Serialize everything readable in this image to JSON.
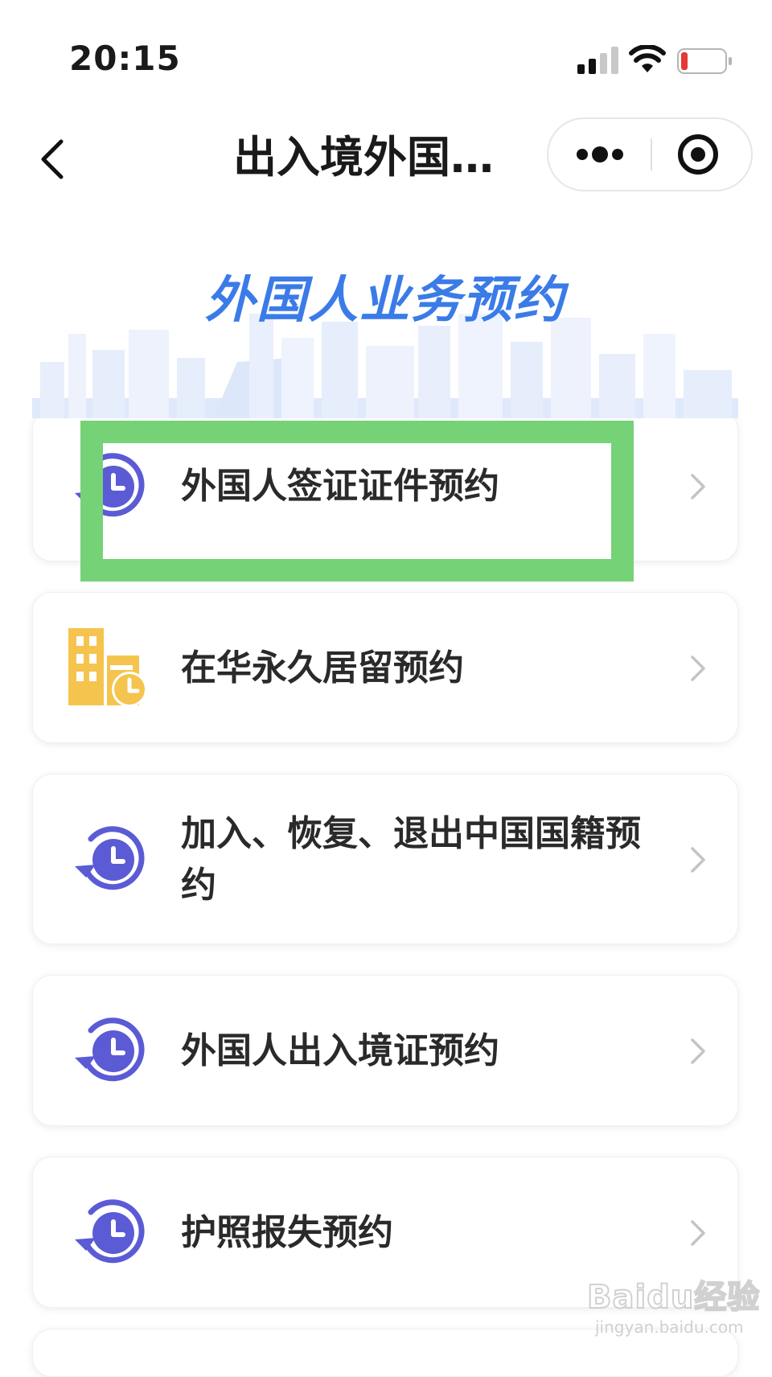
{
  "status_bar": {
    "time": "20:15"
  },
  "nav": {
    "title": "出入境外国…"
  },
  "banner": {
    "title": "外国人业务预约"
  },
  "services": [
    {
      "label": "外国人签证证件预约",
      "icon": "clock-refresh-icon"
    },
    {
      "label": "在华永久居留预约",
      "icon": "building-clock-icon"
    },
    {
      "label": "加入、恢复、退出中国国籍预约",
      "icon": "clock-refresh-icon"
    },
    {
      "label": "外国人出入境证预约",
      "icon": "clock-refresh-icon"
    },
    {
      "label": "护照报失预约",
      "icon": "clock-refresh-icon"
    }
  ],
  "watermark": {
    "brand": "Baidu经验",
    "url": "jingyan.baidu.com"
  },
  "colors": {
    "accent": "#3a7be8",
    "icon_purple": "#5b5bd6",
    "icon_yellow": "#f5c44e",
    "highlight": "#76d277",
    "battery_low": "#e53935"
  }
}
